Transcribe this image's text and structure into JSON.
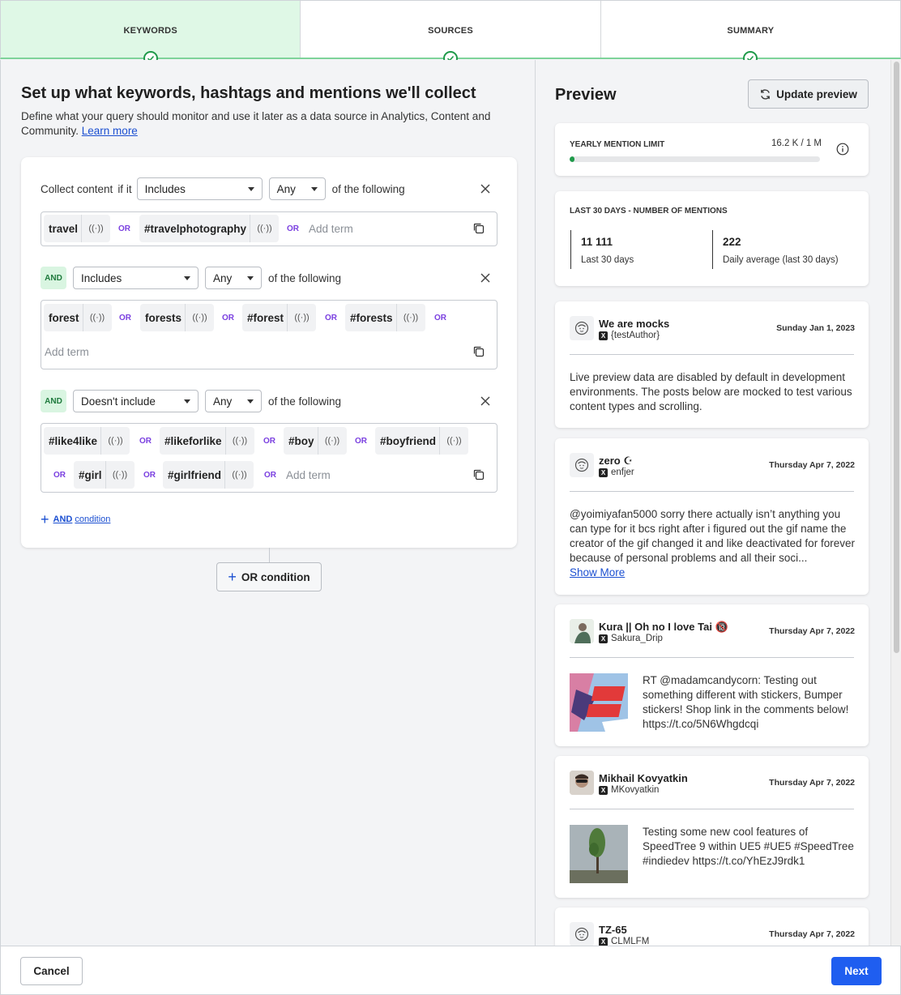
{
  "stepper": {
    "steps": [
      {
        "label": "KEYWORDS",
        "state": "active-complete"
      },
      {
        "label": "SOURCES",
        "state": "complete"
      },
      {
        "label": "SUMMARY",
        "state": "complete"
      }
    ]
  },
  "left": {
    "title": "Set up what keywords, hashtags and mentions we'll collect",
    "description": "Define what your query should monitor and use it later as a data source in Analytics, Content and Community.",
    "learn_more": "Learn more",
    "collect_label": "Collect content",
    "if_it": "if it",
    "of_following": "of the following",
    "or_word": "OR",
    "and_word": "AND",
    "add_term_placeholder": "Add term",
    "conditions": [
      {
        "operator": "Includes",
        "match": "Any",
        "terms": [
          "travel",
          "#travelphotography"
        ]
      },
      {
        "operator": "Includes",
        "match": "Any",
        "terms": [
          "forest",
          "forests",
          "#forest",
          "#forests"
        ]
      },
      {
        "operator": "Doesn't include",
        "match": "Any",
        "terms": [
          "#like4like",
          "#likeforlike",
          "#boy",
          "#boyfriend",
          "#girl",
          "#girlfriend"
        ]
      }
    ],
    "add_and": {
      "bold": "AND",
      "rest": "condition"
    },
    "or_condition": "OR condition"
  },
  "preview": {
    "title": "Preview",
    "update_button": "Update preview",
    "yearly": {
      "title": "YEARLY MENTION LIMIT",
      "value": "16.2 K / 1 M",
      "fill_fraction": 0.0162
    },
    "last30": {
      "title": "LAST 30 DAYS - NUMBER OF MENTIONS",
      "stats": [
        {
          "num": "11 111",
          "label": "Last 30 days"
        },
        {
          "num": "222",
          "label": "Daily average (last 30 days)"
        }
      ]
    },
    "posts": [
      {
        "name": "We are mocks",
        "handle": "{testAuthor}",
        "date": "Sunday Jan 1, 2023",
        "text": "Live preview data are disabled by default in development environments. The posts below are mocked to test various content types and scrolling."
      },
      {
        "name": "zero ☪︎",
        "handle": "enfjer",
        "date": "Thursday Apr 7, 2022",
        "text": "@yoimiyafan5000 sorry there actually isn’t anything you can type for it bcs right after i figured out the gif name the creator of the gif changed it and like deactivated for forever because of personal problems and all their soci...",
        "show_more": "Show More"
      },
      {
        "name": "Kura || Oh no I love Tai 🔞",
        "handle": "Sakura_Drip",
        "date": "Thursday Apr 7, 2022",
        "text": "RT @madamcandycorn: Testing out something different with stickers, Bumper stickers! Shop link in the comments below! https://t.co/5N6Whgdcqi"
      },
      {
        "name": "Mikhail Kovyatkin",
        "handle": "MKovyatkin",
        "date": "Thursday Apr 7, 2022",
        "text": "Testing some new cool features of SpeedTree 9 within UE5 #UE5 #SpeedTree #indiedev https://t.co/YhEzJ9rdk1"
      },
      {
        "name": "TZ-65",
        "handle": "CLMLFM",
        "date": "Thursday Apr 7, 2022"
      }
    ],
    "x_glyph": "X"
  },
  "footer": {
    "cancel": "Cancel",
    "next": "Next"
  },
  "colors": {
    "accent": "#1f5ef0",
    "success": "#1f9a4a",
    "or_purple": "#7a3fe0"
  }
}
